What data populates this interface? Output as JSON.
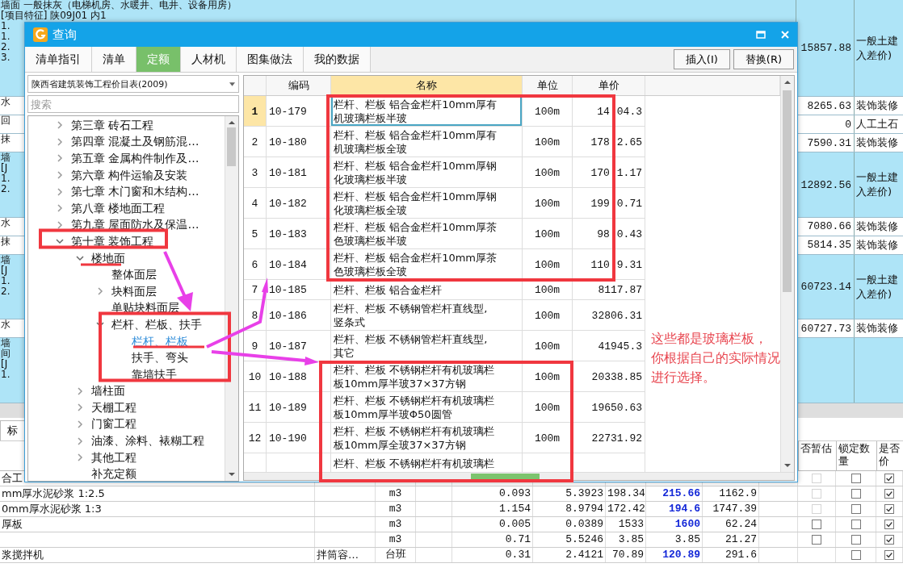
{
  "background_rows": [
    {
      "lines": [
        "墙面  一般抹灰（电梯机房、水暖井、电井、设备用房）",
        "[项目特征]  陕09J01 内1",
        "1.",
        "1.",
        "2.",
        "3."
      ],
      "amount": "15857.88",
      "category": [
        "一般土建",
        "入差价)"
      ],
      "highlight": true
    },
    {
      "lines": [
        "水"
      ],
      "amount": "8265.63",
      "category": [
        "装饰装修"
      ],
      "highlight": false
    },
    {
      "lines": [
        "回"
      ],
      "amount": "0",
      "category": [
        "人工土石"
      ],
      "highlight": false
    },
    {
      "lines": [
        "抹"
      ],
      "amount": "7590.31",
      "category": [
        "装饰装修"
      ],
      "highlight": false
    },
    {
      "lines": [
        "墙",
        "[J",
        "1.",
        "2."
      ],
      "amount": "12892.56",
      "category": [
        "一般土建",
        "入差价)"
      ],
      "highlight": true
    },
    {
      "lines": [
        "水"
      ],
      "amount": "7080.66",
      "category": [
        "装饰装修"
      ],
      "highlight": false
    },
    {
      "lines": [
        "抹"
      ],
      "amount": "5814.35",
      "category": [
        "装饰装修"
      ],
      "highlight": false
    },
    {
      "lines": [
        "墙",
        "[J",
        "1.",
        "2."
      ],
      "amount": "60723.14",
      "category": [
        "一般土建",
        "入差价)"
      ],
      "highlight": true
    },
    {
      "lines": [
        "水"
      ],
      "amount": "60727.73",
      "category": [
        "装饰装修"
      ],
      "highlight": false
    },
    {
      "lines": [
        "墙",
        "间",
        "[J",
        "1."
      ],
      "highlight": true
    }
  ],
  "bottom_tab": "标",
  "bottom_columns": [
    "否暂估",
    "锁定数量",
    "是否价"
  ],
  "bottom_rows": [
    {
      "name": "合工",
      "provisional": {
        "checked": false,
        "disabled": true
      },
      "locked": false,
      "priced": true
    },
    {
      "name": "mm厚水泥砂浆 1:2.5",
      "unit": "m3",
      "qty": "0.093",
      "price": "5.3923",
      "base": "198.34",
      "market": "215.66",
      "highlight": true,
      "total": "1162.9",
      "provisional": {
        "checked": false,
        "disabled": true
      },
      "locked": false,
      "priced": true
    },
    {
      "name": "0mm厚水泥砂浆 1:3",
      "unit": "m3",
      "qty": "1.154",
      "price": "8.9794",
      "base": "172.42",
      "market": "194.6",
      "highlight": true,
      "total": "1747.39",
      "provisional": {
        "checked": false,
        "disabled": true
      },
      "locked": false,
      "priced": true
    },
    {
      "name": "厚板",
      "unit": "m3",
      "qty": "0.005",
      "price": "0.0389",
      "base": "1533",
      "market": "1600",
      "highlight": true,
      "total": "62.24",
      "provisional": {
        "checked": false,
        "disabled": false
      },
      "locked": false,
      "priced": true
    },
    {
      "unit": "m3",
      "qty": "0.71",
      "price": "5.5246",
      "base": "3.85",
      "market": "3.85",
      "highlight": false,
      "total": "21.27",
      "provisional": {
        "checked": false,
        "disabled": false
      },
      "locked": false,
      "priced": true
    },
    {
      "name": "浆搅拌机",
      "spec": "拌筒容…",
      "unit": "台班",
      "qty": "0.31",
      "price": "2.4121",
      "base": "70.89",
      "market": "120.89",
      "highlight": true,
      "total": "291.6",
      "locked": false,
      "priced": true
    }
  ],
  "dialog": {
    "title": "查询",
    "tabs": [
      {
        "label": "清单指引",
        "selected": false
      },
      {
        "label": "清单",
        "selected": false
      },
      {
        "label": "定额",
        "selected": true
      },
      {
        "label": "人材机",
        "selected": false
      },
      {
        "label": "图集做法",
        "selected": false
      },
      {
        "label": "我的数据",
        "selected": false
      }
    ],
    "actions": [
      "插入(I)",
      "替换(R)"
    ],
    "library": "陕西省建筑装饰工程价目表(2009)",
    "search": {
      "placeholder": "搜索"
    },
    "tree": [
      {
        "label": "第三章  砖石工程",
        "expanded": false,
        "selected": false
      },
      {
        "label": "第四章  混凝土及钢筋混…",
        "expanded": false,
        "selected": false
      },
      {
        "label": "第五章  金属构件制作及…",
        "expanded": false,
        "selected": false
      },
      {
        "label": "第六章  构件运输及安装",
        "expanded": false,
        "selected": false
      },
      {
        "label": "第七章  木门窗和木结构…",
        "expanded": false,
        "selected": false
      },
      {
        "label": "第八章  楼地面工程",
        "expanded": false,
        "selected": false
      },
      {
        "label": "第九章  屋面防水及保温…",
        "expanded": false,
        "selected": false
      },
      {
        "label": "第十章  装饰工程",
        "expanded": true,
        "selected": false,
        "children": [
          {
            "label": "楼地面",
            "expanded": true,
            "selected": false,
            "children": [
              {
                "label": "整体面层",
                "selected": false
              },
              {
                "label": "块料面层",
                "expanded": false,
                "selected": false
              },
              {
                "label": "单贴块料面层",
                "selected": false
              },
              {
                "label": "栏杆、栏板、扶手",
                "expanded": true,
                "selected": false,
                "children": [
                  {
                    "label": "栏杆、栏板",
                    "selected": true
                  },
                  {
                    "label": "扶手、弯头",
                    "selected": false
                  },
                  {
                    "label": "靠墙扶手",
                    "selected": false
                  }
                ]
              }
            ]
          },
          {
            "label": "墙柱面",
            "expanded": false,
            "selected": false
          },
          {
            "label": "天棚工程",
            "expanded": false,
            "selected": false
          },
          {
            "label": "门窗工程",
            "expanded": false,
            "selected": false
          },
          {
            "label": "油漆、涂料、裱糊工程",
            "expanded": false,
            "selected": false
          },
          {
            "label": "其他工程",
            "expanded": false,
            "selected": false
          },
          {
            "label": "补充定额",
            "selected": false
          }
        ]
      }
    ],
    "columns": [
      "编码",
      "名称",
      "单位",
      "单价"
    ],
    "rows": [
      {
        "no": "1",
        "code": "10-179",
        "name": [
          "栏杆、栏板 铝合金栏杆10mm厚有",
          "机玻璃栏板半玻"
        ],
        "unit": "100m",
        "price": [
          "14",
          "04.3"
        ],
        "selected": true
      },
      {
        "no": "2",
        "code": "10-180",
        "name": [
          "栏杆、栏板 铝合金栏杆10mm厚有",
          "机玻璃栏板全玻"
        ],
        "unit": "100m",
        "price": [
          "178",
          "2.65"
        ],
        "selected": false
      },
      {
        "no": "3",
        "code": "10-181",
        "name": [
          "栏杆、栏板 铝合金栏杆10mm厚钢",
          "化玻璃栏板半玻"
        ],
        "unit": "100m",
        "price": [
          "170",
          "1.17"
        ],
        "selected": false
      },
      {
        "no": "4",
        "code": "10-182",
        "name": [
          "栏杆、栏板 铝合金栏杆10mm厚钢",
          "化玻璃栏板全玻"
        ],
        "unit": "100m",
        "price": [
          "199",
          "0.71"
        ],
        "selected": false
      },
      {
        "no": "5",
        "code": "10-183",
        "name": [
          "栏杆、栏板 铝合金栏杆10mm厚茶",
          "色玻璃栏板半玻"
        ],
        "unit": "100m",
        "price": [
          "98",
          "0.43"
        ],
        "selected": false
      },
      {
        "no": "6",
        "code": "10-184",
        "name": [
          "栏杆、栏板 铝合金栏杆10mm厚茶",
          "色玻璃栏板全玻"
        ],
        "unit": "100m",
        "price": [
          "110",
          "9.31"
        ],
        "selected": false
      },
      {
        "no": "7",
        "code": "10-185",
        "name": [
          "栏杆、栏板 铝合金栏杆"
        ],
        "unit": "100m",
        "price": [
          "8117.87"
        ],
        "selected": false
      },
      {
        "no": "8",
        "code": "10-186",
        "name": [
          "栏杆、栏板 不锈钢管栏杆直线型,",
          "竖条式"
        ],
        "unit": "100m",
        "price": [
          "32806.31"
        ],
        "selected": false
      },
      {
        "no": "9",
        "code": "10-187",
        "name": [
          "栏杆、栏板 不锈钢管栏杆直线型,",
          "其它"
        ],
        "unit": "100m",
        "price": [
          "41945.3"
        ],
        "selected": false
      },
      {
        "no": "10",
        "code": "10-188",
        "name": [
          "栏杆、栏板 不锈钢栏杆有机玻璃栏",
          "板10mm厚半玻37×37方钢"
        ],
        "unit": "100m",
        "price": [
          "20338.85"
        ],
        "selected": false
      },
      {
        "no": "11",
        "code": "10-189",
        "name": [
          "栏杆、栏板 不锈钢栏杆有机玻璃栏",
          "板10mm厚半玻Φ50圆管"
        ],
        "unit": "100m",
        "price": [
          "19650.63"
        ],
        "selected": false
      },
      {
        "no": "12",
        "code": "10-190",
        "name": [
          "栏杆、栏板 不锈钢栏杆有机玻璃栏",
          "板10mm厚全玻37×37方钢"
        ],
        "unit": "100m",
        "price": [
          "22731.92"
        ],
        "selected": false
      },
      {
        "name": [
          "栏杆、栏板 不锈钢栏杆有机玻璃栏"
        ],
        "selected": false
      }
    ]
  },
  "note": [
    "这些都是玻璃栏板，",
    "你根据自己的实际情况",
    "进行选择。"
  ]
}
